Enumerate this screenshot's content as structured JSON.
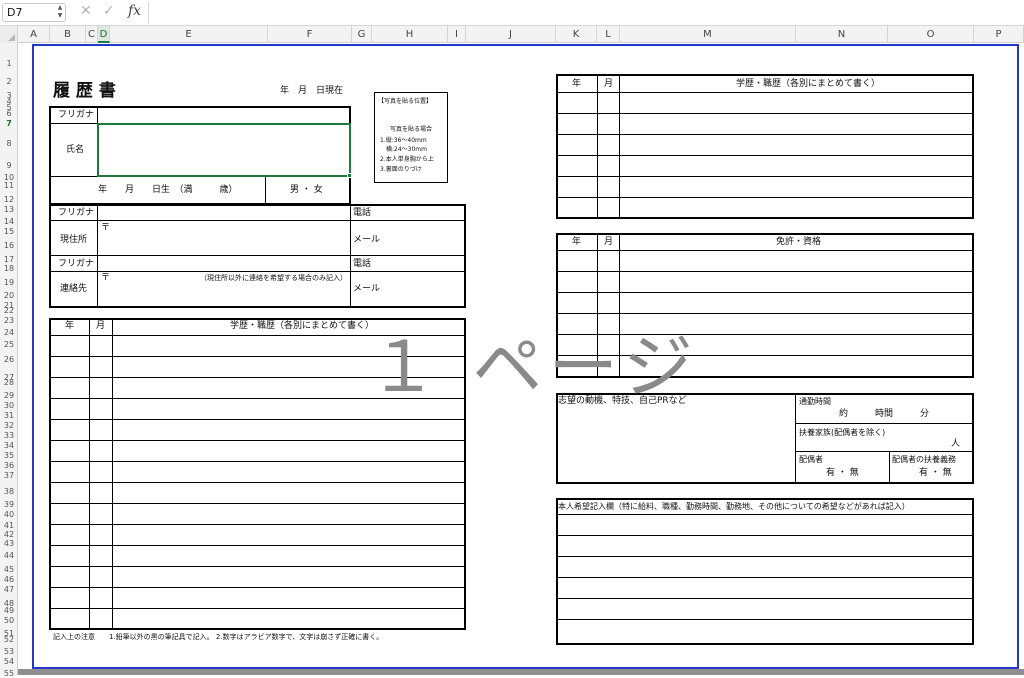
{
  "formula_bar": {
    "name_box": "D7",
    "cancel_icon": "close-icon",
    "confirm_icon": "check-icon",
    "fx_label": "fx",
    "formula_value": ""
  },
  "columns": [
    "A",
    "B",
    "C",
    "D",
    "E",
    "F",
    "G",
    "H",
    "I",
    "J",
    "K",
    "L",
    "M",
    "N",
    "O",
    "P"
  ],
  "selected_column": "D",
  "rows": [
    "1",
    "2",
    "3",
    "4",
    "5",
    "6",
    "7",
    "8",
    "9",
    "10",
    "11",
    "12",
    "13",
    "14",
    "15",
    "16",
    "17",
    "18",
    "19",
    "20",
    "21",
    "22",
    "23",
    "24",
    "25",
    "26",
    "27",
    "28",
    "29",
    "30",
    "31",
    "32",
    "33",
    "34",
    "35",
    "36",
    "37",
    "38",
    "39",
    "40",
    "41",
    "42",
    "43",
    "44",
    "45",
    "46",
    "47",
    "48",
    "49",
    "50",
    "51",
    "52",
    "53",
    "54",
    "55"
  ],
  "selected_row": "7",
  "watermark": "１ ページ",
  "resume": {
    "title": "履 歴 書",
    "date_line": "年　月　日現在",
    "furigana_label": "フリガナ",
    "name_label": "氏名",
    "birth_line": "年　　月　　日生　（満　　　歳）",
    "gender": "男 ・ 女",
    "address_furigana": "フリガナ",
    "address_label": "現住所",
    "postal_mark": "〒",
    "phone_label": "電話",
    "email_label": "メール",
    "contact_furigana": "フリガナ",
    "contact_label": "連絡先",
    "contact_postal": "〒",
    "contact_note": "（現住所以外に連絡を希望する場合のみ記入）",
    "contact_phone": "電話",
    "contact_email": "メール",
    "photo": {
      "title": "【写真を貼る位置】",
      "heading": "写真を貼る場合",
      "lines": [
        "1.縦:36〜40mm",
        "　横:24〜30mm",
        "2.本人単身胸から上",
        "3.裏面のりづけ"
      ]
    },
    "history_left": {
      "year": "年",
      "month": "月",
      "header": "学歴・職歴（各別にまとめて書く）"
    },
    "notes": "記入上の注意　　1.鉛筆以外の黒の筆記具で記入。 2.数字はアラビア数字で、文字は崩さず正確に書く。",
    "history_right": {
      "year": "年",
      "month": "月",
      "header": "学歴・職歴（各別にまとめて書く）"
    },
    "license": {
      "year": "年",
      "month": "月",
      "header": "免許・資格"
    },
    "motivation": {
      "label": "志望の動機、特技、自己PRなど",
      "commute_label": "通勤時間",
      "commute_value": "約　　　時間　　　分",
      "dependents_label": "扶養家族(配偶者を除く)",
      "dependents_unit": "人",
      "spouse_label": "配偶者",
      "spouse_value": "有 ・ 無",
      "spouse_support_label": "配偶者の扶養義務",
      "spouse_support_value": "有 ・ 無"
    },
    "wishes": {
      "header": "本人希望記入欄（特に給料、職種、勤務時間、勤務地、その他についての希望などがあれば記入）"
    }
  }
}
